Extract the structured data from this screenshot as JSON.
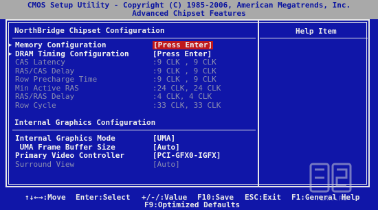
{
  "title": {
    "line1": "CMOS Setup Utility - Copyright (C) 1985-2006, American Megatrends, Inc.",
    "line2": "Advanced Chipset Features"
  },
  "panel": {
    "section1": "NorthBridge Chipset Configuration",
    "section2": "Internal Graphics Configuration",
    "help_title": "Help Item"
  },
  "items": [
    {
      "label": "Memory Configuration",
      "value": "[Press Enter]",
      "submenu": true,
      "style": "selected"
    },
    {
      "label": "DRAM Timing Configuration",
      "value": "[Press Enter]",
      "submenu": true,
      "style": "active"
    },
    {
      "label": "CAS Latency",
      "value": ":9 CLK , 9 CLK",
      "style": "disabled"
    },
    {
      "label": "RAS/CAS Delay",
      "value": ":9 CLK , 9 CLK",
      "style": "disabled"
    },
    {
      "label": "Row Precharge Time",
      "value": ":9 CLK , 9 CLK",
      "style": "disabled"
    },
    {
      "label": "Min Active RAS",
      "value": ":24 CLK, 24 CLK",
      "style": "disabled"
    },
    {
      "label": "RAS/RAS Delay",
      "value": ":4 CLK, 4 CLK",
      "style": "disabled"
    },
    {
      "label": "Row Cycle",
      "value": ":33 CLK, 33 CLK",
      "style": "disabled"
    }
  ],
  "gfx_items": [
    {
      "label": "Internal Graphics Mode",
      "value": "[UMA]",
      "style": "active"
    },
    {
      "label": " UMA Frame Buffer Size",
      "value": "[Auto]",
      "style": "active"
    },
    {
      "label": "Primary Video Controller",
      "value": "[PCI-GFX0-IGFX]",
      "style": "active"
    },
    {
      "label": "Surround View",
      "value": "[Auto]",
      "style": "disabled"
    }
  ],
  "footer": {
    "move": "↑↓←→:Move",
    "select": "Enter:Select",
    "value": "+/-/:Value",
    "save": "F10:Save",
    "exit": "ESC:Exit",
    "help": "F1:General Help",
    "defaults": "F9:Optimized Defaults"
  },
  "watermark": "FERRA.RU",
  "colors": {
    "background": "#1016a8",
    "title_bar": "#a9a9a9",
    "highlight": "#c0181c",
    "disabled_text": "#8c8fb0"
  }
}
